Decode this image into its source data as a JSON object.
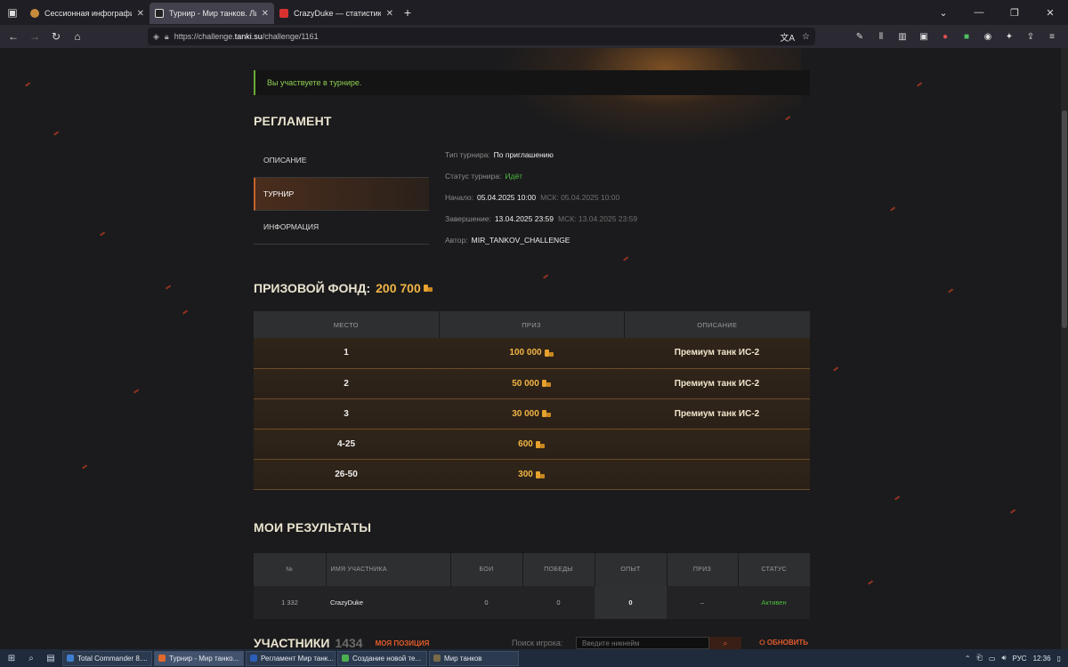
{
  "browser": {
    "tabs": [
      {
        "title": "Сессионная инфографика",
        "active": false
      },
      {
        "title": "Турнир - Мир танков. Личный",
        "active": true
      },
      {
        "title": "CrazyDuke — статистика игрок",
        "active": false
      }
    ],
    "url_prefix": "https://challenge.",
    "url_domain": "tanki.su",
    "url_path": "/challenge/1161"
  },
  "notice": "Вы участвуете в турнире.",
  "reglament": {
    "title": "РЕГЛАМЕНТ",
    "menu": [
      {
        "label": "ОПИСАНИЕ",
        "active": false
      },
      {
        "label": "ТУРНИР",
        "active": true
      },
      {
        "label": "ИНФОРМАЦИЯ",
        "active": false
      }
    ],
    "info": {
      "type_label": "Тип турнира:",
      "type_value": "По приглашению",
      "status_label": "Статус турнира:",
      "status_value": "Идёт",
      "start_label": "Начало:",
      "start_value": "05.04.2025 10:00",
      "start_msk": "МСК: 05.04.2025 10:00",
      "end_label": "Завершение:",
      "end_value": "13.04.2025 23:59",
      "end_msk": "МСК: 13.04.2025 23:59",
      "author_label": "Автор:",
      "author_value": "MIR_TANKOV_CHALLENGE"
    }
  },
  "prize": {
    "title": "ПРИЗОВОЙ ФОНД:",
    "amount": "200 700",
    "headers": [
      "МЕСТО",
      "ПРИЗ",
      "ОПИСАНИЕ"
    ],
    "rows": [
      {
        "place": "1",
        "prize": "100 000",
        "desc": "Премиум танк ИС-2"
      },
      {
        "place": "2",
        "prize": "50 000",
        "desc": "Премиум танк ИС-2"
      },
      {
        "place": "3",
        "prize": "30 000",
        "desc": "Премиум танк ИС-2"
      },
      {
        "place": "4-25",
        "prize": "600",
        "desc": ""
      },
      {
        "place": "26-50",
        "prize": "300",
        "desc": ""
      }
    ]
  },
  "results": {
    "title": "МОИ РЕЗУЛЬТАТЫ",
    "headers": [
      "№",
      "ИМЯ УЧАСТНИКА",
      "БОИ",
      "ПОБЕДЫ",
      "ОПЫТ",
      "ПРИЗ",
      "СТАТУС"
    ],
    "row": {
      "num": "1 332",
      "name": "CrazyDuke",
      "battles": "0",
      "wins": "0",
      "exp": "0",
      "prize": "–",
      "status": "Активен"
    }
  },
  "participants": {
    "title": "УЧАСТНИКИ",
    "count": "1434",
    "my_position": "МОЯ ПОЗИЦИЯ",
    "search_label": "Поиск игрока:",
    "search_placeholder": "Введите никнейм",
    "refresh": "ОБНОВИТЬ"
  },
  "taskbar": {
    "apps": [
      {
        "label": "Total Commander 8....",
        "color": "#3f7fd0"
      },
      {
        "label": "Турнир - Мир танко...",
        "color": "#e0692c"
      },
      {
        "label": "Регламент Мир танк...",
        "color": "#2b5fb8"
      },
      {
        "label": "Создание новой те...",
        "color": "#4caf50"
      },
      {
        "label": "Мир танков",
        "color": "#7a6a4a"
      }
    ],
    "lang": "РУС",
    "time": "12:36"
  }
}
